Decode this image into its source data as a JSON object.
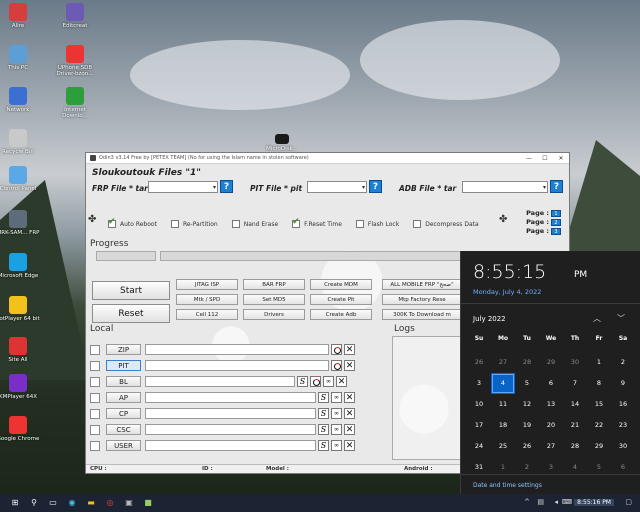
{
  "desktop": {
    "icons": [
      {
        "label": "Alire",
        "color": "#d63d3d"
      },
      {
        "label": "Editcreat",
        "color": "#6b5bb5"
      },
      {
        "label": "This PC",
        "color": "#5e9ed6"
      },
      {
        "label": "UPhone SDB Driver-bzon...",
        "color": "#e33"
      },
      {
        "label": "Network",
        "color": "#3b6fd1"
      },
      {
        "label": "Internet Downlo...",
        "color": "#2e9e3a"
      },
      {
        "label": "Recycle Bin",
        "color": "#c9c9c9"
      },
      {
        "label": "Control Panel",
        "color": "#5aa9e6"
      },
      {
        "label": "MRK-SAM... FRP",
        "color": "#5d6b7a"
      },
      {
        "label": "Microsoft Edge",
        "color": "#1ba1e2"
      },
      {
        "label": "PotPlayer 64 bit",
        "color": "#f2c21b"
      },
      {
        "label": "Site All",
        "color": "#d33"
      },
      {
        "label": "KMPlayer 64X",
        "color": "#7a2ec8"
      },
      {
        "label": "Google Chrome",
        "color": "#e33"
      }
    ],
    "floating_icon_label": "MicroDisk..."
  },
  "odin": {
    "window_title": "Odin3 v3.14 Free by [PETEX TEAM] (No for using the Islam name in stolen software)",
    "heading": "Sloukoutouk Files \"1\"",
    "frp_label": "FRP File * tar",
    "pit_label": "PIT File * pit",
    "adb_label": "ADB File * tar",
    "help_symbol": "?",
    "options": [
      {
        "label": "Auto Reboot",
        "checked": true
      },
      {
        "label": "Re-Partition",
        "checked": false
      },
      {
        "label": "Nand Erase",
        "checked": false
      },
      {
        "label": "F.Reset Time",
        "checked": true
      },
      {
        "label": "Flash Lock",
        "checked": false
      },
      {
        "label": "Decompress Data",
        "checked": false
      }
    ],
    "page_label": "Page :",
    "progress_label": "Progress",
    "start_label": "Start",
    "reset_label": "Reset",
    "small_buttons": [
      [
        "JITAG ISP",
        "BAR FRP",
        "Create MDM"
      ],
      [
        "Mtk / SPD",
        "Set MD5",
        "Create Pit"
      ],
      [
        "Cell 112",
        "Drivers",
        "Create Adb"
      ]
    ],
    "right_buttons": [
      "ALL MOBILE FRP \"صحح\"",
      "Mtp Factory Rese",
      "300K To Download m"
    ],
    "local_label": "Local",
    "logs_label": "Logs",
    "file_rows": [
      "ZIP",
      "PIT",
      "BL",
      "AP",
      "CP",
      "CSC",
      "USER"
    ],
    "status": {
      "cpu": "CPU :",
      "id": "ID :",
      "model": "Model :",
      "android": "Android :"
    }
  },
  "clock": {
    "time": "8:55:15",
    "ampm": "PM",
    "date": "Monday, July 4, 2022",
    "month": "July 2022",
    "weekdays": [
      "Su",
      "Mo",
      "Tu",
      "We",
      "Th",
      "Fr",
      "Sa"
    ],
    "weeks": [
      [
        "26",
        "27",
        "28",
        "29",
        "30",
        "1",
        "2"
      ],
      [
        "3",
        "4",
        "5",
        "6",
        "7",
        "8",
        "9"
      ],
      [
        "10",
        "11",
        "12",
        "13",
        "14",
        "15",
        "16"
      ],
      [
        "17",
        "18",
        "19",
        "20",
        "21",
        "22",
        "23"
      ],
      [
        "24",
        "25",
        "26",
        "27",
        "28",
        "29",
        "30"
      ],
      [
        "31",
        "1",
        "2",
        "3",
        "4",
        "5",
        "6"
      ]
    ],
    "today": "4",
    "settings_link": "Date and time settings"
  },
  "taskbar": {
    "time": "8:55:16 PM"
  }
}
